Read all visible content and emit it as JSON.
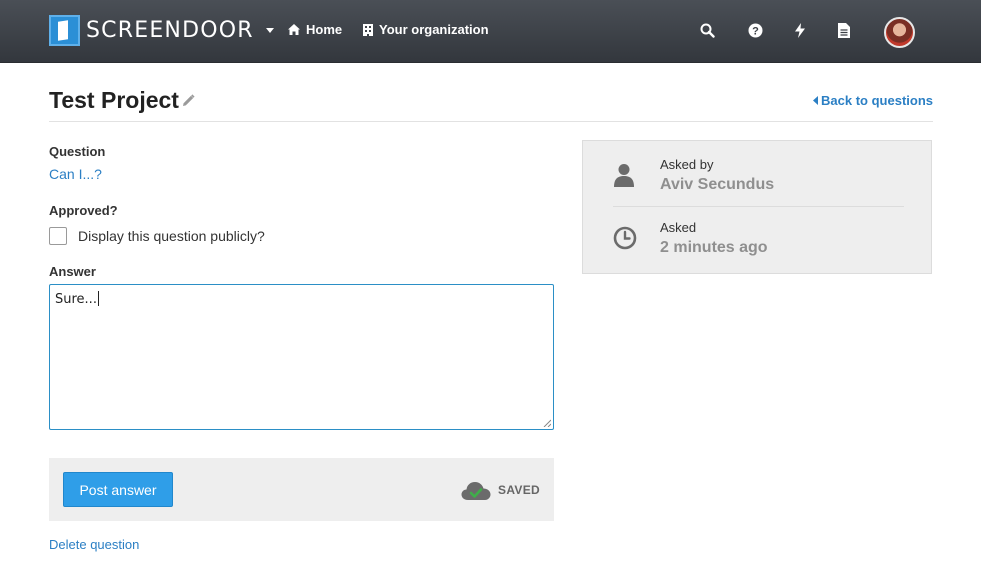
{
  "brand": {
    "name": "SCREENDOOR"
  },
  "nav": {
    "home_label": "Home",
    "org_label": "Your organization",
    "icons": [
      "search-icon",
      "help-icon",
      "bolt-icon",
      "document-icon"
    ]
  },
  "page": {
    "title": "Test Project",
    "back_label": "Back to questions"
  },
  "form": {
    "question_label": "Question",
    "question_text": "Can I...?",
    "approved_label": "Approved?",
    "checkbox_label": "Display this question publicly?",
    "checkbox_checked": false,
    "answer_label": "Answer",
    "answer_value": "Sure..."
  },
  "actions": {
    "post_label": "Post answer",
    "saved_label": "SAVED",
    "delete_label": "Delete question"
  },
  "info": {
    "asked_by_label": "Asked by",
    "asked_by_value": "Aviv Secundus",
    "asked_label": "Asked",
    "asked_value": "2 minutes ago"
  },
  "colors": {
    "accent": "#2f9ee8",
    "link": "#2b7fc4",
    "topbar": "#3d4147"
  }
}
